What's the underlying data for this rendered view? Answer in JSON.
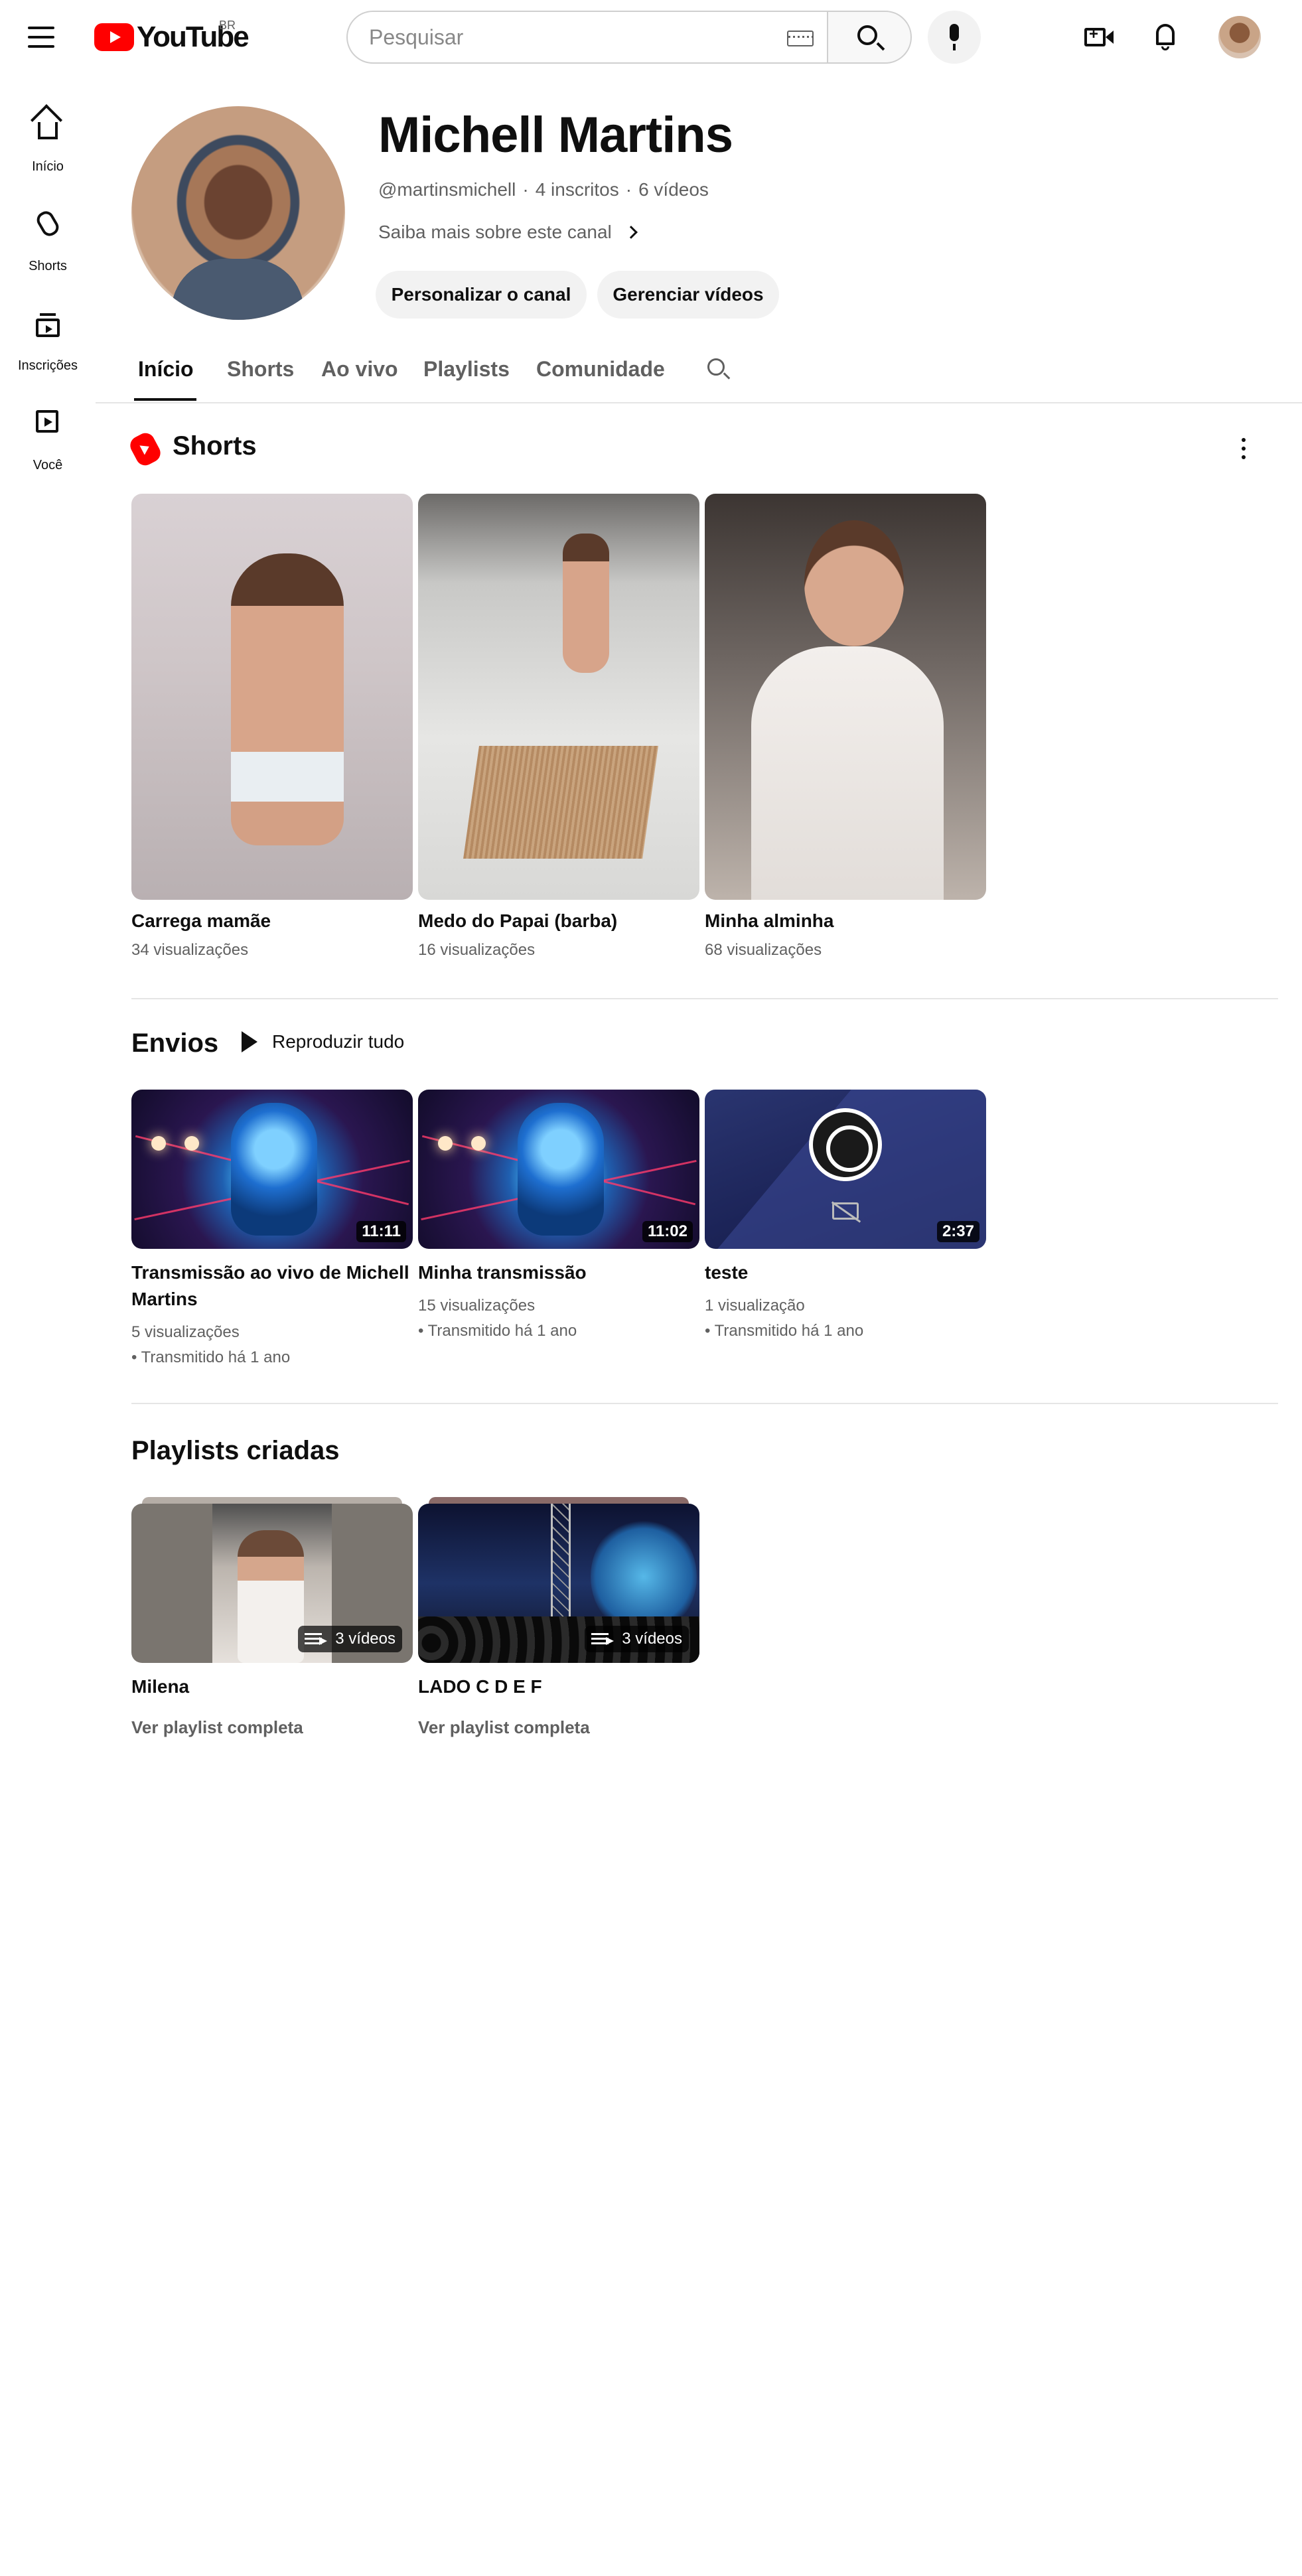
{
  "header": {
    "logo_text": "YouTube",
    "country": "BR",
    "search_placeholder": "Pesquisar"
  },
  "sidebar": {
    "items": [
      {
        "label": "Início",
        "icon": "home-icon"
      },
      {
        "label": "Shorts",
        "icon": "shorts-icon"
      },
      {
        "label": "Inscrições",
        "icon": "subscriptions-icon"
      },
      {
        "label": "Você",
        "icon": "you-icon"
      }
    ]
  },
  "channel": {
    "name": "Michell Martins",
    "handle": "@martinsmichell",
    "subscribers": "4 inscritos",
    "videos": "6 vídeos",
    "separator": "·",
    "about": "Saiba mais sobre este canal",
    "customize_label": "Personalizar o canal",
    "manage_label": "Gerenciar vídeos"
  },
  "tabs": [
    "Início",
    "Shorts",
    "Ao vivo",
    "Playlists",
    "Comunidade"
  ],
  "shorts_section": {
    "title": "Shorts",
    "items": [
      {
        "title": "Carrega mamãe",
        "views": "34 visualizações"
      },
      {
        "title": "Medo do Papai (barba)",
        "views": "16 visualizações"
      },
      {
        "title": "Minha alminha",
        "views": "68 visualizações"
      }
    ]
  },
  "uploads_section": {
    "title": "Envios",
    "play_all": "Reproduzir tudo",
    "items": [
      {
        "title": "Transmissão ao vivo de Michell Martins",
        "duration": "11:11",
        "views": "5 visualizações",
        "when": "• Transmitido há 1 ano"
      },
      {
        "title": "Minha transmissão",
        "duration": "11:02",
        "views": "15 visualizações",
        "when": "• Transmitido há 1 ano"
      },
      {
        "title": "teste",
        "duration": "2:37",
        "views": "1 visualização",
        "when": "• Transmitido há 1 ano"
      }
    ]
  },
  "playlists_section": {
    "title": "Playlists criadas",
    "items": [
      {
        "title": "Milena",
        "count": "3 vídeos",
        "link": "Ver playlist completa"
      },
      {
        "title": "LADO C D E F",
        "count": "3 vídeos",
        "link": "Ver playlist completa"
      }
    ]
  },
  "colors": {
    "brand_red": "#ff0000",
    "text_primary": "#0f0f0f",
    "text_secondary": "#606060",
    "pill_bg": "#f2f2f2"
  }
}
